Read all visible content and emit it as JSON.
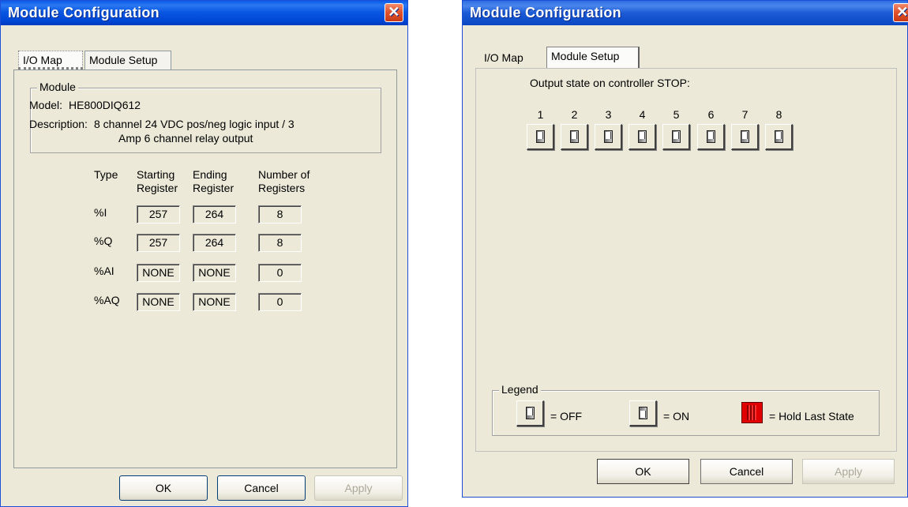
{
  "left_dialog": {
    "title": "Module Configuration",
    "tabs": [
      "I/O Map",
      "Module Setup"
    ],
    "module_group": {
      "label": "Module",
      "model_label": "Model:",
      "model_value": "HE800DIQ612",
      "description_label": "Description:",
      "description_line1": "8 channel 24 VDC pos/neg logic input / 3",
      "description_line2": "Amp 6 channel relay output"
    },
    "table": {
      "headers": {
        "type": "Type",
        "start_1": "Starting",
        "start_2": "Register",
        "end_1": "Ending",
        "end_2": "Register",
        "num_1": "Number of",
        "num_2": "Registers"
      },
      "rows": [
        {
          "type": "%I",
          "start": "257",
          "end": "264",
          "count": "8"
        },
        {
          "type": "%Q",
          "start": "257",
          "end": "264",
          "count": "8"
        },
        {
          "type": "%AI",
          "start": "NONE",
          "end": "NONE",
          "count": "0"
        },
        {
          "type": "%AQ",
          "start": "NONE",
          "end": "NONE",
          "count": "0"
        }
      ]
    },
    "buttons": {
      "ok": "OK",
      "cancel": "Cancel",
      "apply": "Apply"
    }
  },
  "right_dialog": {
    "title": "Module Configuration",
    "tabs": [
      "I/O Map",
      "Module Setup"
    ],
    "output_state_label": "Output state on controller STOP:",
    "channels": [
      "1",
      "2",
      "3",
      "4",
      "5",
      "6",
      "7",
      "8"
    ],
    "channel_states": [
      "OFF",
      "OFF",
      "OFF",
      "OFF",
      "OFF",
      "OFF",
      "OFF",
      "OFF"
    ],
    "legend": {
      "label": "Legend",
      "off_text": "= OFF",
      "on_text": "= ON",
      "hold_text": "= Hold Last State"
    },
    "buttons": {
      "ok": "OK",
      "cancel": "Cancel",
      "apply": "Apply"
    }
  },
  "colors": {
    "titlebar": "#0a58e2",
    "dialog_bg": "#ece9d8",
    "close_button": "#e0502a",
    "hold_icon": "#e00000"
  }
}
